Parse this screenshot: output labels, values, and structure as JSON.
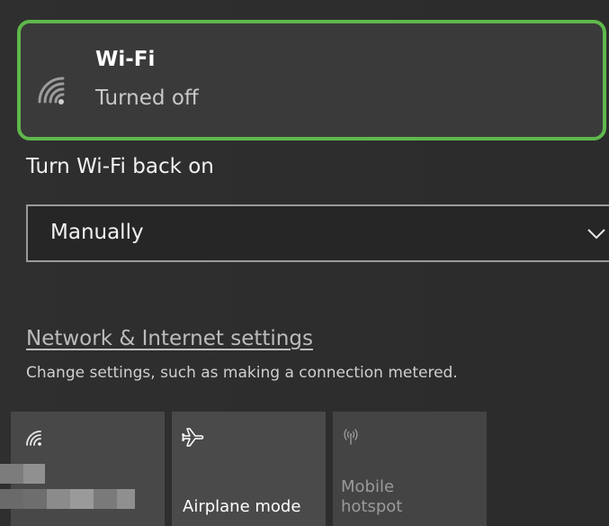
{
  "wifi": {
    "title": "Wi-Fi",
    "status": "Turned off",
    "icon": "wifi-signal-icon",
    "border_color": "#5fb84b"
  },
  "auto_on": {
    "label": "Turn Wi-Fi back on",
    "selected": "Manually"
  },
  "network_settings": {
    "link": "Network & Internet settings",
    "description": "Change settings, such as making a connection metered."
  },
  "quick_actions": [
    {
      "label": "",
      "icon": "wifi-icon"
    },
    {
      "label": "Airplane mode",
      "icon": "airplane-icon"
    },
    {
      "label": "Mobile\nhotspot",
      "icon": "mobile-hotspot-icon",
      "disabled": true
    }
  ]
}
